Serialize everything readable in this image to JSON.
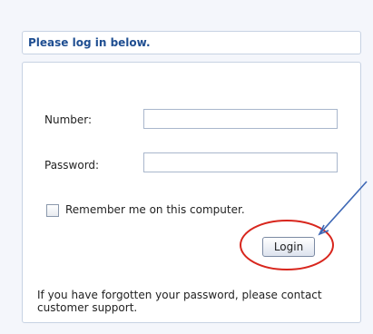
{
  "header": {
    "title": "Please log in below."
  },
  "form": {
    "number_label": "Number:",
    "number_value": "",
    "password_label": "Password:",
    "password_value": "",
    "remember_label": "Remember me on this computer.",
    "remember_checked": false,
    "login_label": "Login"
  },
  "footer": {
    "message": "If you have forgotten your password, please contact customer support."
  },
  "annotations": {
    "circle_color": "#d8261d",
    "arrow_color": "#3d67b5"
  }
}
